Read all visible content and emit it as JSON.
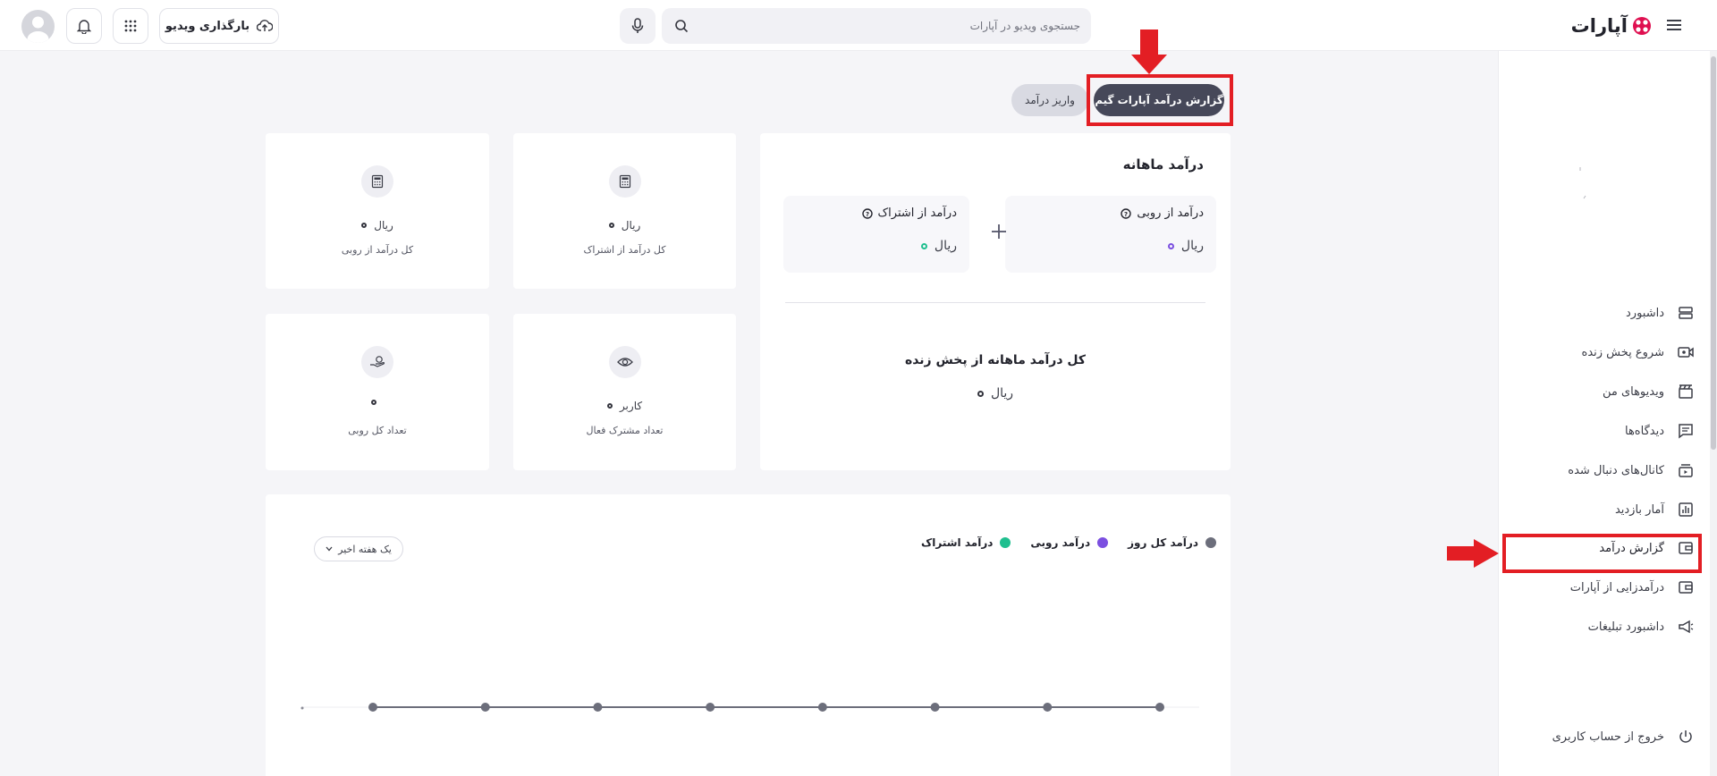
{
  "header": {
    "logo_text": "آپارات",
    "search_placeholder": "جستجوی ویدیو در آپارات",
    "upload_label": "بارگذاری ویدیو"
  },
  "tabs": {
    "active_label": "گزارش درآمد آپارات گیم",
    "deposit_label": "واریز درآمد"
  },
  "monthly": {
    "title": "درآمد ماهانه",
    "rubi_label": "درآمد از روبی",
    "rubi_value": "ریال",
    "subscription_label": "درآمد از اشتراک",
    "subscription_value": "ریال",
    "live_title": "کل درآمد ماهانه از پخش زنده",
    "live_value": "ریال"
  },
  "stats": [
    {
      "value": "ریال",
      "caption": "کل درآمد از اشتراک",
      "icon": "calculator-icon"
    },
    {
      "value": "ریال",
      "caption": "کل درآمد از روبی",
      "icon": "calculator-icon"
    },
    {
      "value": "کاربر",
      "caption": "تعداد مشترک فعال",
      "icon": "eye-icon"
    },
    {
      "value": "",
      "caption": "تعداد کل روبی",
      "icon": "hand-coin-icon"
    }
  ],
  "chart": {
    "legend": [
      {
        "name": "درآمد کل روز",
        "color": "#6c6e7b"
      },
      {
        "name": "درآمد روبی",
        "color": "#7b4fe0"
      },
      {
        "name": "درآمد اشتراک",
        "color": "#1fbf8f"
      }
    ],
    "range_label": "یک هفته اخیر"
  },
  "chart_data": {
    "type": "line",
    "series": [
      {
        "name": "درآمد کل روز",
        "values": [
          0,
          0,
          0,
          0,
          0,
          0,
          0,
          0
        ]
      }
    ],
    "xlabel": "",
    "ylabel": ""
  },
  "sidebar": {
    "items": [
      {
        "label": "داشبورد",
        "icon": "dashboard-icon"
      },
      {
        "label": "شروع پخش زنده",
        "icon": "live-stream-icon"
      },
      {
        "label": "ویدیوهای من",
        "icon": "clapperboard-icon"
      },
      {
        "label": "دیدگاه‌ها",
        "icon": "comment-icon"
      },
      {
        "label": "کانال‌های دنبال شده",
        "icon": "channels-icon"
      },
      {
        "label": "آمار بازدید",
        "icon": "stats-icon"
      },
      {
        "label": "گزارش درآمد",
        "icon": "wallet-icon"
      },
      {
        "label": "درآمدزایی از آپارات",
        "icon": "wallet-icon"
      },
      {
        "label": "داشبورد تبلیغات",
        "icon": "megaphone-icon"
      }
    ],
    "logout_label": "خروج از حساب کاربری"
  },
  "colors": {
    "accent_dark": "#464859",
    "annotation_red": "#e31e24",
    "brand_red": "#df0f50"
  }
}
